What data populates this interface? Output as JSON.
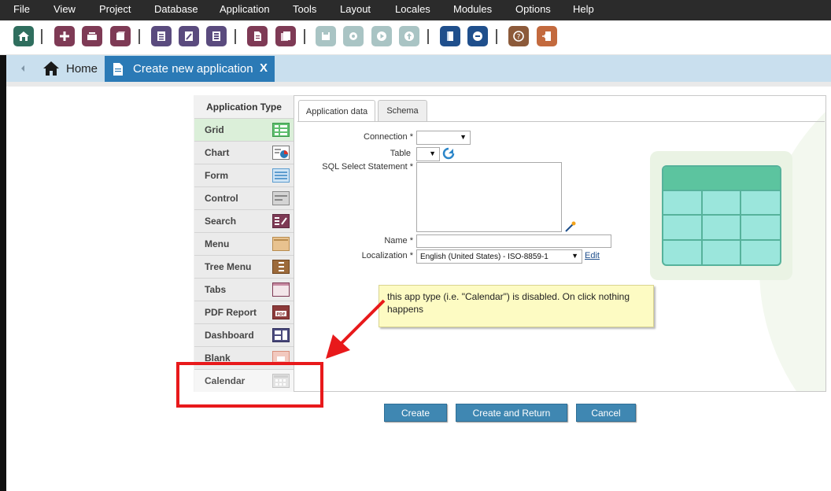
{
  "menu": [
    "File",
    "View",
    "Project",
    "Database",
    "Application",
    "Tools",
    "Layout",
    "Locales",
    "Modules",
    "Options",
    "Help"
  ],
  "tabs": {
    "home_label": "Home",
    "create_label": "Create new application",
    "close_label": "X"
  },
  "app_type": {
    "header": "Application Type",
    "items": [
      "Grid",
      "Chart",
      "Form",
      "Control",
      "Search",
      "Menu",
      "Tree Menu",
      "Tabs",
      "PDF Report",
      "Dashboard",
      "Blank",
      "Calendar"
    ]
  },
  "inner_tabs": [
    "Application data",
    "Schema"
  ],
  "form": {
    "connection_label": "Connection *",
    "connection_value": "",
    "table_label": "Table",
    "table_value": "",
    "sql_label": "SQL Select Statement *",
    "sql_value": "",
    "name_label": "Name *",
    "name_value": "",
    "localization_label": "Localization *",
    "localization_value": "English (United States) - ISO-8859-1",
    "edit_link": "Edit"
  },
  "tooltip": "this app type (i.e. \"Calendar\") is disabled. On click nothing happens",
  "buttons": {
    "create": "Create",
    "create_return": "Create and Return",
    "cancel": "Cancel"
  },
  "colors": {
    "menubar": "#2b2b2b",
    "tab_active": "#2b7ab6",
    "tabbar": "#c9dfee",
    "button": "#3f87b2",
    "tooltip": "#fdfbc3",
    "highlight": "#e8191b",
    "grid_selected": "#dbefd9"
  },
  "toolbar_icons": [
    "home-icon",
    "add-icon",
    "open-icon",
    "box-icon",
    "grid-add-icon",
    "grid-edit-icon",
    "grid-list-icon",
    "document-icon",
    "documents-icon",
    "save-icon",
    "settings-icon",
    "run-icon",
    "deploy-icon",
    "book-icon",
    "chat-icon",
    "help-icon",
    "exit-icon"
  ]
}
